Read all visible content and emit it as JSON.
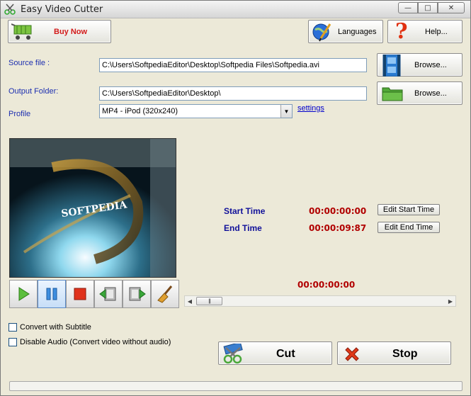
{
  "window": {
    "title": "Easy Video Cutter",
    "minimize": "—",
    "maximize": "□",
    "close": "✕"
  },
  "toolbar": {
    "buy_now": "Buy Now",
    "languages": "Languages",
    "help": "Help..."
  },
  "form": {
    "source_label": "Source file :",
    "source_value": "C:\\Users\\SoftpediaEditor\\Desktop\\Softpedia Files\\Softpedia.avi",
    "output_label": "Output Folder:",
    "output_value": "C:\\Users\\SoftpediaEditor\\Desktop\\",
    "profile_label": "Profile",
    "profile_value": "MP4 - iPod (320x240)",
    "settings_link": "settings",
    "browse_source": "Browse...",
    "browse_output": "Browse..."
  },
  "preview": {
    "overlay_text": "SOFTPEDIA"
  },
  "timing": {
    "start_label": "Start Time",
    "start_value": "00:00:00:00",
    "end_label": "End Time",
    "end_value": "00:00:09:87",
    "edit_start": "Edit Start Time",
    "edit_end": "Edit End Time",
    "current_value": "00:00:00:00"
  },
  "options": {
    "subtitle": "Convert with Subtitle",
    "disable_audio": "Disable Audio (Convert video without audio)"
  },
  "actions": {
    "cut": "Cut",
    "stop": "Stop"
  },
  "progress": {
    "value": 0
  },
  "colors": {
    "label_blue": "#1d2fb0",
    "time_red": "#b10000",
    "link_blue": "#0000cc"
  }
}
